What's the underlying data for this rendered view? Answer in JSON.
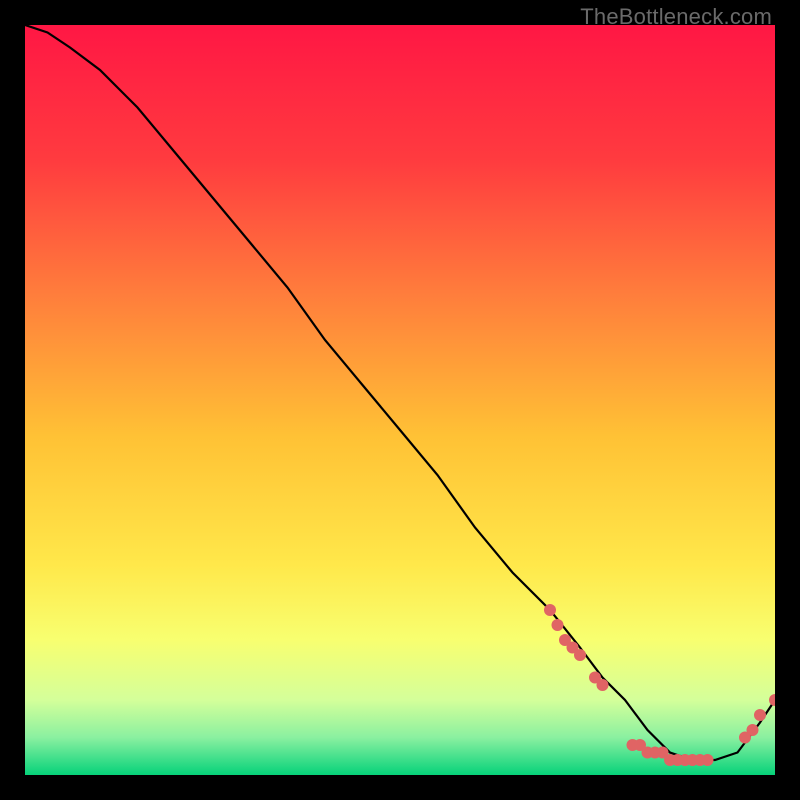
{
  "watermark": "TheBottleneck.com",
  "chart_data": {
    "type": "line",
    "title": "",
    "xlabel": "",
    "ylabel": "",
    "xlim": [
      0,
      100
    ],
    "ylim": [
      0,
      100
    ],
    "background_gradient": {
      "stops": [
        {
          "offset": 0.0,
          "color": "#ff1744"
        },
        {
          "offset": 0.18,
          "color": "#ff3b3f"
        },
        {
          "offset": 0.35,
          "color": "#ff7a3c"
        },
        {
          "offset": 0.55,
          "color": "#ffc235"
        },
        {
          "offset": 0.72,
          "color": "#ffe84a"
        },
        {
          "offset": 0.82,
          "color": "#f8ff70"
        },
        {
          "offset": 0.9,
          "color": "#d4ff9a"
        },
        {
          "offset": 0.95,
          "color": "#8af0a0"
        },
        {
          "offset": 1.0,
          "color": "#06d27a"
        }
      ]
    },
    "series": [
      {
        "name": "bottleneck-curve",
        "x": [
          0,
          3,
          6,
          10,
          15,
          20,
          25,
          30,
          35,
          40,
          45,
          50,
          55,
          60,
          65,
          70,
          74,
          77,
          80,
          83,
          86,
          89,
          92,
          95,
          98,
          100
        ],
        "y": [
          100,
          99,
          97,
          94,
          89,
          83,
          77,
          71,
          65,
          58,
          52,
          46,
          40,
          33,
          27,
          22,
          17,
          13,
          10,
          6,
          3,
          2,
          2,
          3,
          7,
          10
        ]
      }
    ],
    "points": {
      "name": "highlight-dots",
      "color": "#e06464",
      "coords": [
        {
          "x": 70,
          "y": 22
        },
        {
          "x": 71,
          "y": 20
        },
        {
          "x": 72,
          "y": 18
        },
        {
          "x": 73,
          "y": 17
        },
        {
          "x": 74,
          "y": 16
        },
        {
          "x": 76,
          "y": 13
        },
        {
          "x": 77,
          "y": 12
        },
        {
          "x": 81,
          "y": 4
        },
        {
          "x": 82,
          "y": 4
        },
        {
          "x": 83,
          "y": 3
        },
        {
          "x": 84,
          "y": 3
        },
        {
          "x": 85,
          "y": 3
        },
        {
          "x": 86,
          "y": 2
        },
        {
          "x": 87,
          "y": 2
        },
        {
          "x": 88,
          "y": 2
        },
        {
          "x": 89,
          "y": 2
        },
        {
          "x": 90,
          "y": 2
        },
        {
          "x": 91,
          "y": 2
        },
        {
          "x": 96,
          "y": 5
        },
        {
          "x": 97,
          "y": 6
        },
        {
          "x": 98,
          "y": 8
        },
        {
          "x": 100,
          "y": 10
        }
      ]
    }
  }
}
